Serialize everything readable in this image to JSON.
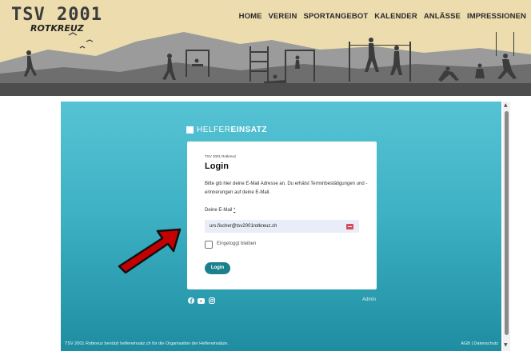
{
  "site": {
    "logo_line1": "TSV 2001",
    "logo_line2": "ROTKREUZ"
  },
  "nav": [
    {
      "label": "HOME"
    },
    {
      "label": "VEREIN"
    },
    {
      "label": "SPORTANGEBOT"
    },
    {
      "label": "KALENDER"
    },
    {
      "label": "ANLÄSSE"
    },
    {
      "label": "IMPRESSIONEN"
    }
  ],
  "widget": {
    "brand_light": "HELFER",
    "brand_bold": "EINSATZ",
    "org_name": "TSV 2001 Rotkreuz",
    "title": "Login",
    "description": "Bitte gib hier deine E-Mail Adresse an. Du erhälst Terminbestätigungen und -erinnerungen auf deine E-Mail.",
    "email_label": "Deine E-Mail",
    "email_required_mark": "*",
    "email_value": "urs.fischer@tsv2001rotkreuz.ch",
    "remember_label": "Eingeloggt bleiben",
    "login_button": "Login",
    "admin_link": "Admin",
    "social_icons": [
      "facebook-icon",
      "youtube-icon",
      "instagram-icon"
    ]
  },
  "footer": {
    "left": "TSV 2001 Rotkreuz benützt helfereinsatz.ch für die Organisation der Helfereinsätze.",
    "right": "AGB | Datenschutz"
  },
  "colors": {
    "accent": "#1c7f8c",
    "background_teal": "#3eb1c4",
    "header_sand": "#ecdcae",
    "annotation_arrow": "#c40000"
  }
}
